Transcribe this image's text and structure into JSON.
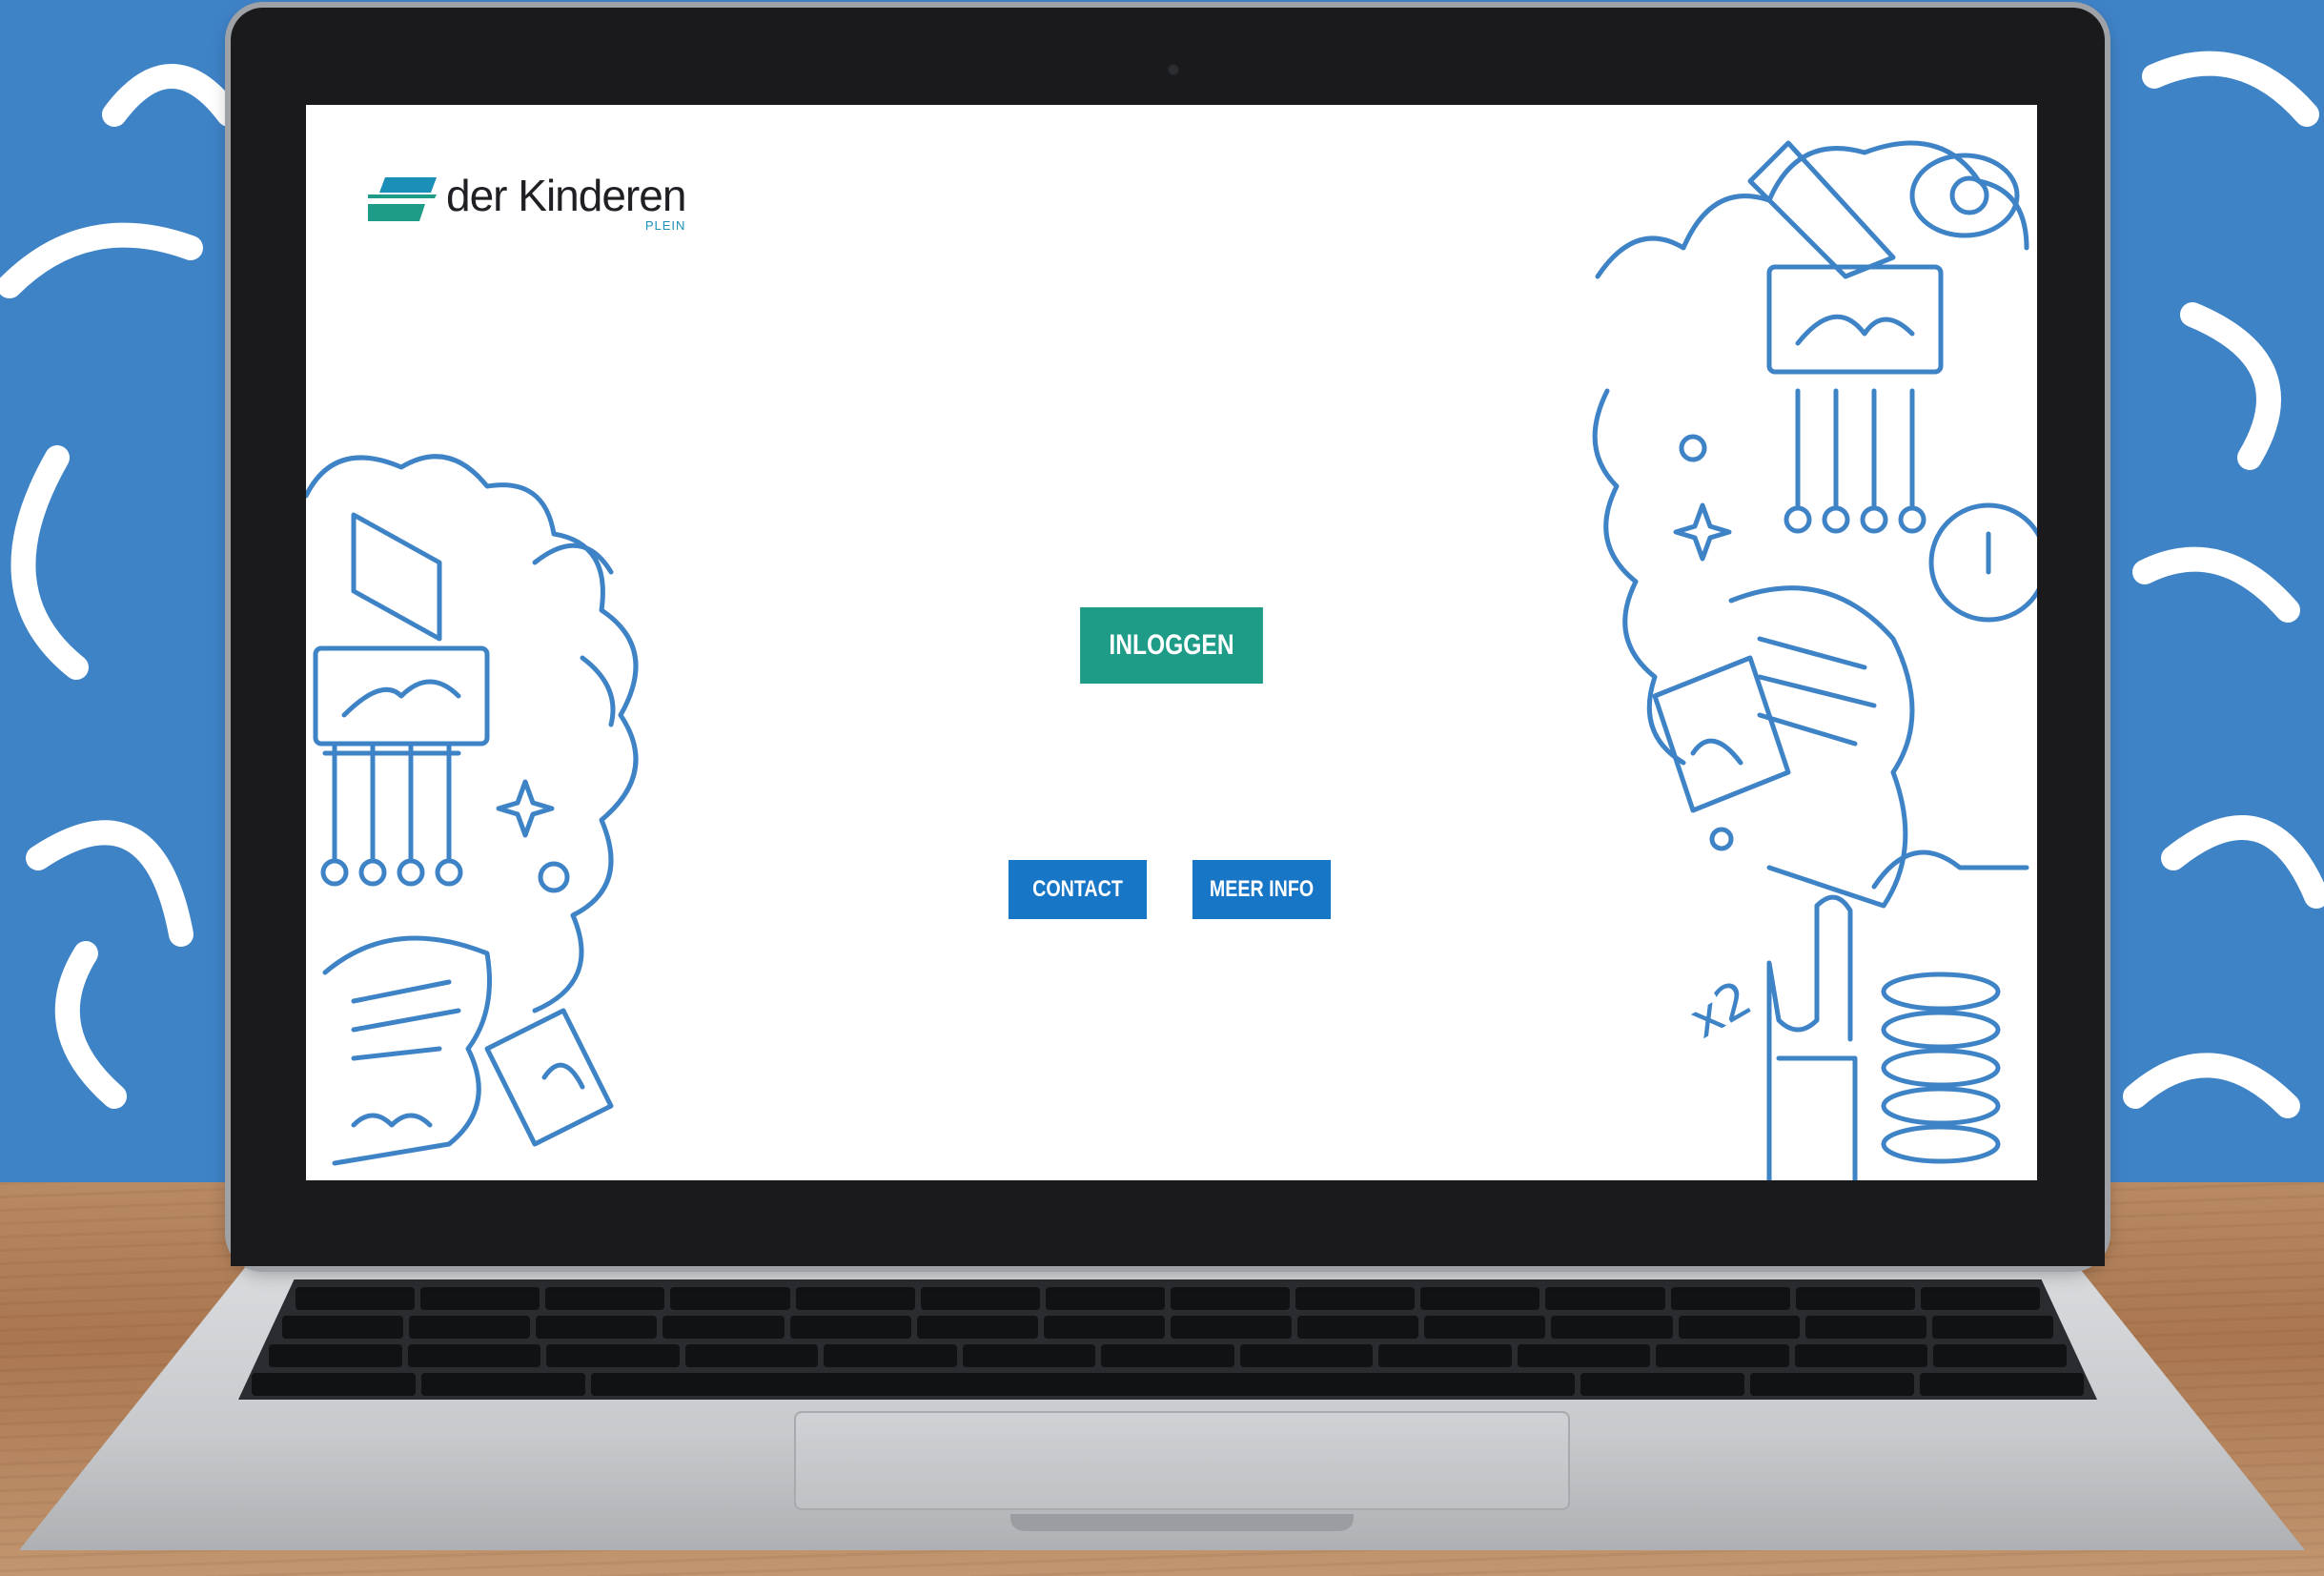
{
  "brand": {
    "name": "der Kinderen",
    "sub": "PLEIN",
    "colors": {
      "teal": "#1f9c88",
      "blue": "#1876c6",
      "doodle": "#3f83c7"
    }
  },
  "actions": {
    "login_label": "INLOGGEN",
    "contact_label": "CONTACT",
    "info_label": "MEER INFO"
  },
  "illustration": {
    "left_icon": "doodle-illustration",
    "right_icon": "doodle-illustration",
    "right_note": "x2"
  }
}
